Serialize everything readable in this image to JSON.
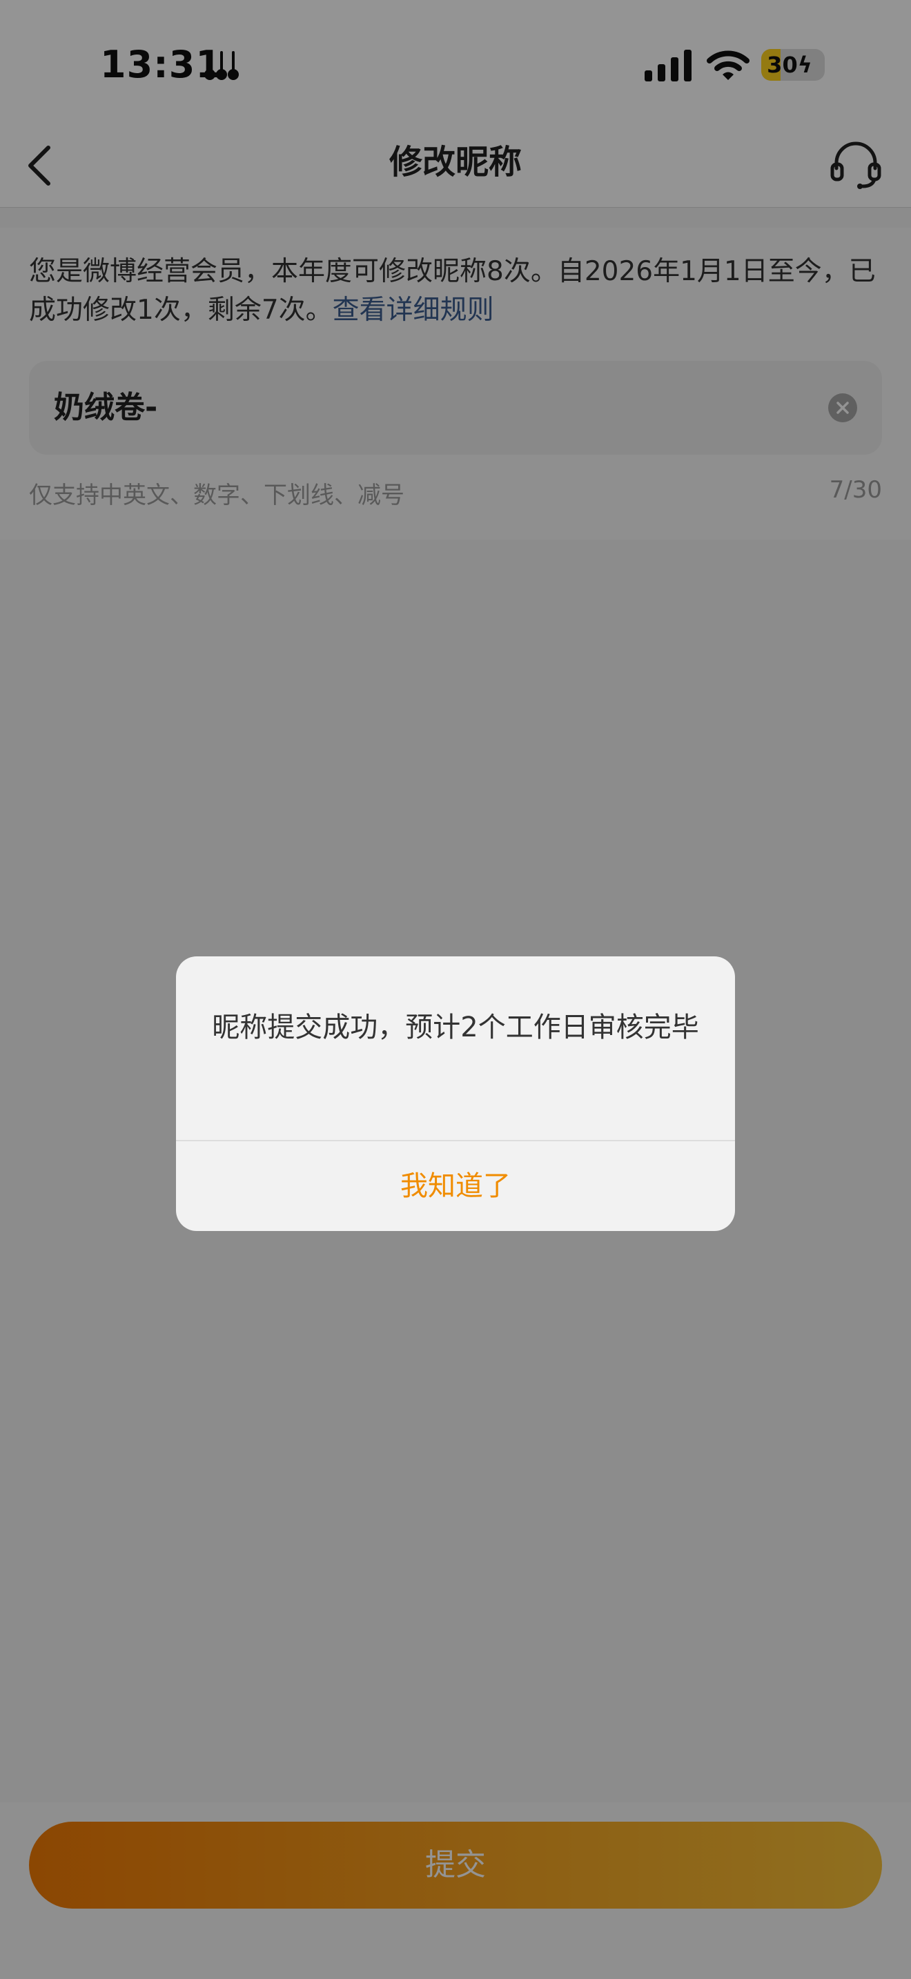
{
  "status_bar": {
    "time": "13:31",
    "extra_icon": "accessibility-guitar-icon",
    "battery_percent": 30,
    "battery_text": "30",
    "icons": [
      "signal-icon",
      "wifi-icon",
      "battery-charging-icon"
    ]
  },
  "nav": {
    "title": "修改昵称",
    "back_icon": "chevron-left-icon",
    "support_icon": "headset-icon"
  },
  "notice": {
    "text": "您是微博经营会员，本年度可修改昵称8次。自2026年1月1日至今，已成功修改1次，剩余7次。",
    "link_text": "查看详细规则"
  },
  "nickname_field": {
    "value": "奶绒卷-",
    "clear_icon": "clear-circle-icon"
  },
  "hint": {
    "text": "仅支持中英文、数字、下划线、减号",
    "counter": "7/30"
  },
  "submit": {
    "label": "提交"
  },
  "dialog": {
    "message": "昵称提交成功，预计2个工作日审核完毕",
    "confirm_label": "我知道了"
  },
  "colors": {
    "accent": "#f08c00",
    "link": "#3b5c8e",
    "submit_gradient_start": "#f07a05",
    "submit_gradient_end": "#f7c038",
    "overlay": "rgba(0,0,0,0.42)"
  }
}
